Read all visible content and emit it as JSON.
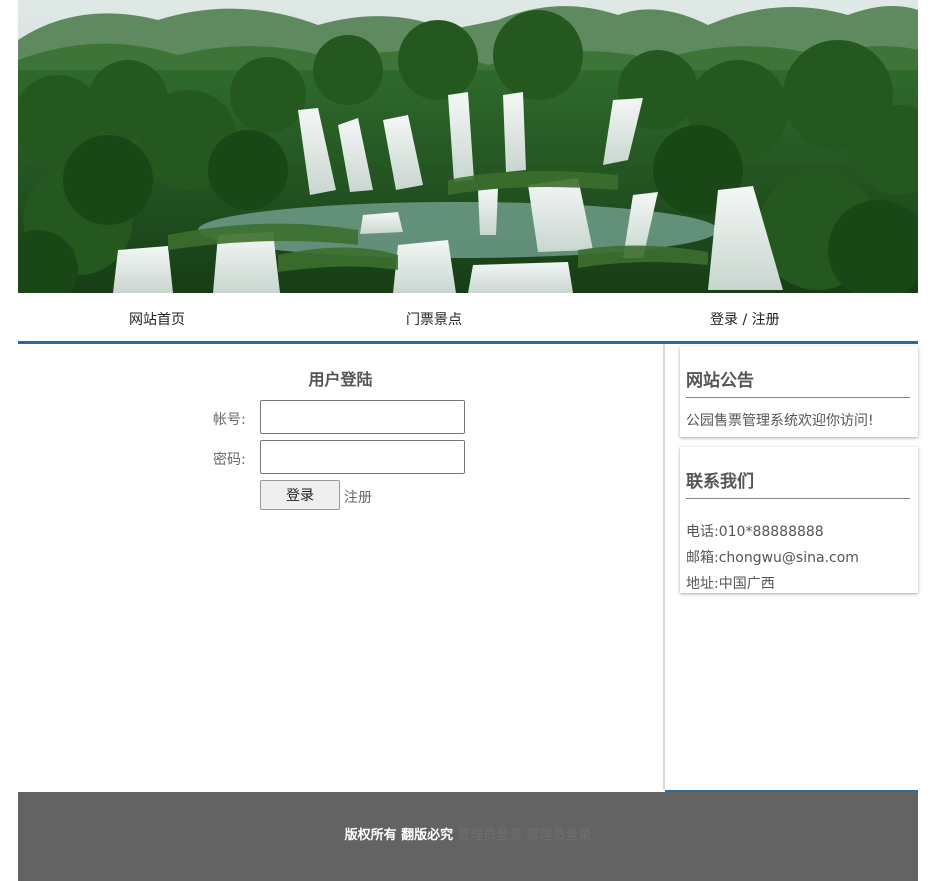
{
  "nav": {
    "home": "网站首页",
    "tickets": "门票景点",
    "login_register": "登录 / 注册"
  },
  "login": {
    "title": "用户登陆",
    "account_label": "帐号:",
    "password_label": "密码:",
    "account_value": "",
    "password_value": "",
    "submit_label": "登录",
    "register_link": "注册"
  },
  "sidebar": {
    "notice": {
      "title": "网站公告",
      "text": "公园售票管理系统欢迎你访问!"
    },
    "contact": {
      "title": "联系我们",
      "phone": "电话:010*88888888",
      "email": "邮箱:chongwu@sina.com",
      "address": "地址:中国广西"
    }
  },
  "footer": {
    "copyright": "版权所有 翻版必究",
    "admin_link_1": "管理员登录",
    "admin_link_2": "管理员登录"
  },
  "colors": {
    "accent": "#2a6aa0",
    "footer_bg": "#636363"
  }
}
